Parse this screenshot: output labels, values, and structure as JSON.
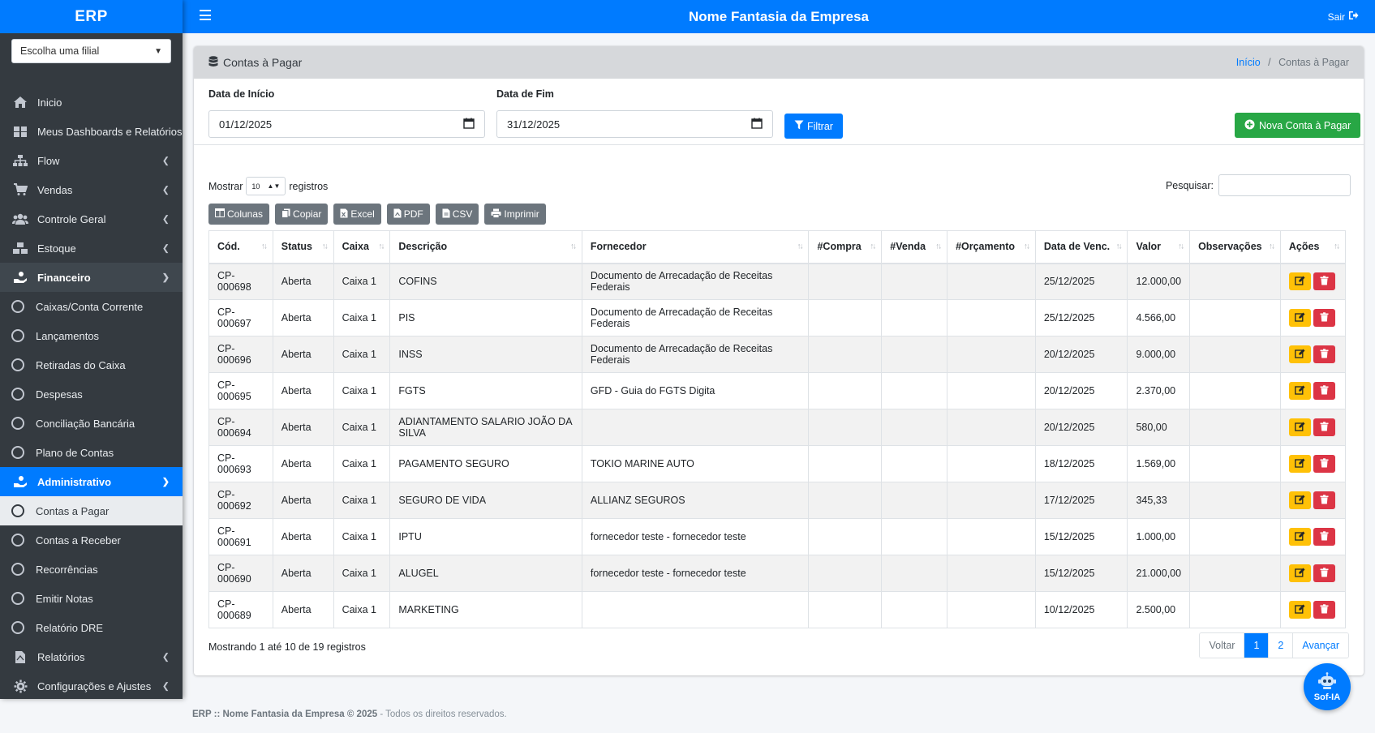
{
  "sidebar": {
    "brand": "ERP",
    "branch_select": "Escolha uma filial",
    "items": [
      {
        "label": "Inicio",
        "icon": "home-icon"
      },
      {
        "label": "Meus Dashboards e Relatórios",
        "icon": "dashboard-icon"
      },
      {
        "label": "Flow",
        "icon": "sitemap-icon"
      },
      {
        "label": "Vendas",
        "icon": "cart-icon"
      },
      {
        "label": "Controle Geral",
        "icon": "users-icon"
      },
      {
        "label": "Estoque",
        "icon": "boxes-icon"
      },
      {
        "label": "Financeiro",
        "icon": "hand-coin-icon"
      },
      {
        "label": "Caixas/Conta Corrente"
      },
      {
        "label": "Lançamentos"
      },
      {
        "label": "Retiradas do Caixa"
      },
      {
        "label": "Despesas"
      },
      {
        "label": "Conciliação Bancária"
      },
      {
        "label": "Plano de Contas"
      },
      {
        "label": "Administrativo",
        "icon": "hand-coin-icon"
      },
      {
        "label": "Contas a Pagar"
      },
      {
        "label": "Contas a Receber"
      },
      {
        "label": "Recorrências"
      },
      {
        "label": "Emitir Notas"
      },
      {
        "label": "Relatório DRE"
      },
      {
        "label": "Relatórios",
        "icon": "file-pdf-icon"
      },
      {
        "label": "Configurações e Ajustes",
        "icon": "gear-icon"
      }
    ]
  },
  "topbar": {
    "title": "Nome Fantasia da Empresa",
    "logout": "Sair"
  },
  "page": {
    "title": "Contas à Pagar",
    "breadcrumb_home": "Início",
    "breadcrumb_sep": "/",
    "breadcrumb_current": "Contas à Pagar"
  },
  "filters": {
    "start_label": "Data de Início",
    "start_value": "01/12/2025",
    "end_label": "Data de Fim",
    "end_value": "31/12/2025",
    "filter_button": "Filtrar",
    "new_button": "Nova Conta à Pagar"
  },
  "table_controls": {
    "show_label": "Mostrar",
    "page_length": "10",
    "records_label": "registros",
    "search_label": "Pesquisar:",
    "search_value": "",
    "buttons": [
      "Colunas",
      "Copiar",
      "Excel",
      "PDF",
      "CSV",
      "Imprimir"
    ]
  },
  "table": {
    "columns": [
      "Cód.",
      "Status",
      "Caixa",
      "Descrição",
      "Fornecedor",
      "#Compra",
      "#Venda",
      "#Orçamento",
      "Data de Venc.",
      "Valor",
      "Observações",
      "Ações"
    ],
    "rows": [
      {
        "cod": "CP-000698",
        "status": "Aberta",
        "caixa": "Caixa 1",
        "descricao": "COFINS",
        "fornecedor": "Documento de Arrecadação de Receitas Federais",
        "compra": "",
        "venda": "",
        "orcamento": "",
        "vencimento": "25/12/2025",
        "valor": "12.000,00",
        "obs": ""
      },
      {
        "cod": "CP-000697",
        "status": "Aberta",
        "caixa": "Caixa 1",
        "descricao": "PIS",
        "fornecedor": "Documento de Arrecadação de Receitas Federais",
        "compra": "",
        "venda": "",
        "orcamento": "",
        "vencimento": "25/12/2025",
        "valor": "4.566,00",
        "obs": ""
      },
      {
        "cod": "CP-000696",
        "status": "Aberta",
        "caixa": "Caixa 1",
        "descricao": "INSS",
        "fornecedor": "Documento de Arrecadação de Receitas Federais",
        "compra": "",
        "venda": "",
        "orcamento": "",
        "vencimento": "20/12/2025",
        "valor": "9.000,00",
        "obs": ""
      },
      {
        "cod": "CP-000695",
        "status": "Aberta",
        "caixa": "Caixa 1",
        "descricao": "FGTS",
        "fornecedor": "GFD - Guia do FGTS Digita",
        "compra": "",
        "venda": "",
        "orcamento": "",
        "vencimento": "20/12/2025",
        "valor": "2.370,00",
        "obs": ""
      },
      {
        "cod": "CP-000694",
        "status": "Aberta",
        "caixa": "Caixa 1",
        "descricao": "ADIANTAMENTO SALARIO JOÃO DA SILVA",
        "fornecedor": "",
        "compra": "",
        "venda": "",
        "orcamento": "",
        "vencimento": "20/12/2025",
        "valor": "580,00",
        "obs": ""
      },
      {
        "cod": "CP-000693",
        "status": "Aberta",
        "caixa": "Caixa 1",
        "descricao": "PAGAMENTO SEGURO",
        "fornecedor": "TOKIO MARINE AUTO",
        "compra": "",
        "venda": "",
        "orcamento": "",
        "vencimento": "18/12/2025",
        "valor": "1.569,00",
        "obs": ""
      },
      {
        "cod": "CP-000692",
        "status": "Aberta",
        "caixa": "Caixa 1",
        "descricao": "SEGURO DE VIDA",
        "fornecedor": "ALLIANZ SEGUROS",
        "compra": "",
        "venda": "",
        "orcamento": "",
        "vencimento": "17/12/2025",
        "valor": "345,33",
        "obs": ""
      },
      {
        "cod": "CP-000691",
        "status": "Aberta",
        "caixa": "Caixa 1",
        "descricao": "IPTU",
        "fornecedor": "fornecedor teste - fornecedor teste",
        "compra": "",
        "venda": "",
        "orcamento": "",
        "vencimento": "15/12/2025",
        "valor": "1.000,00",
        "obs": ""
      },
      {
        "cod": "CP-000690",
        "status": "Aberta",
        "caixa": "Caixa 1",
        "descricao": "ALUGEL",
        "fornecedor": "fornecedor teste - fornecedor teste",
        "compra": "",
        "venda": "",
        "orcamento": "",
        "vencimento": "15/12/2025",
        "valor": "21.000,00",
        "obs": ""
      },
      {
        "cod": "CP-000689",
        "status": "Aberta",
        "caixa": "Caixa 1",
        "descricao": "MARKETING",
        "fornecedor": "",
        "compra": "",
        "venda": "",
        "orcamento": "",
        "vencimento": "10/12/2025",
        "valor": "2.500,00",
        "obs": ""
      }
    ]
  },
  "pagination": {
    "info": "Mostrando 1 até 10 de 19 registros",
    "prev": "Voltar",
    "pages": [
      "1",
      "2"
    ],
    "next": "Avançar"
  },
  "footer": {
    "brand": "ERP :: Nome Fantasia da Empresa © 2025",
    "rights": " - Todos os direitos reservados."
  },
  "assistant": {
    "label": "Sof-IA"
  },
  "colors": {
    "primary": "#007bff",
    "sidebar": "#343a40",
    "success": "#28a745",
    "warning": "#ffc107",
    "danger": "#dc3545",
    "secondary": "#6c757d"
  }
}
